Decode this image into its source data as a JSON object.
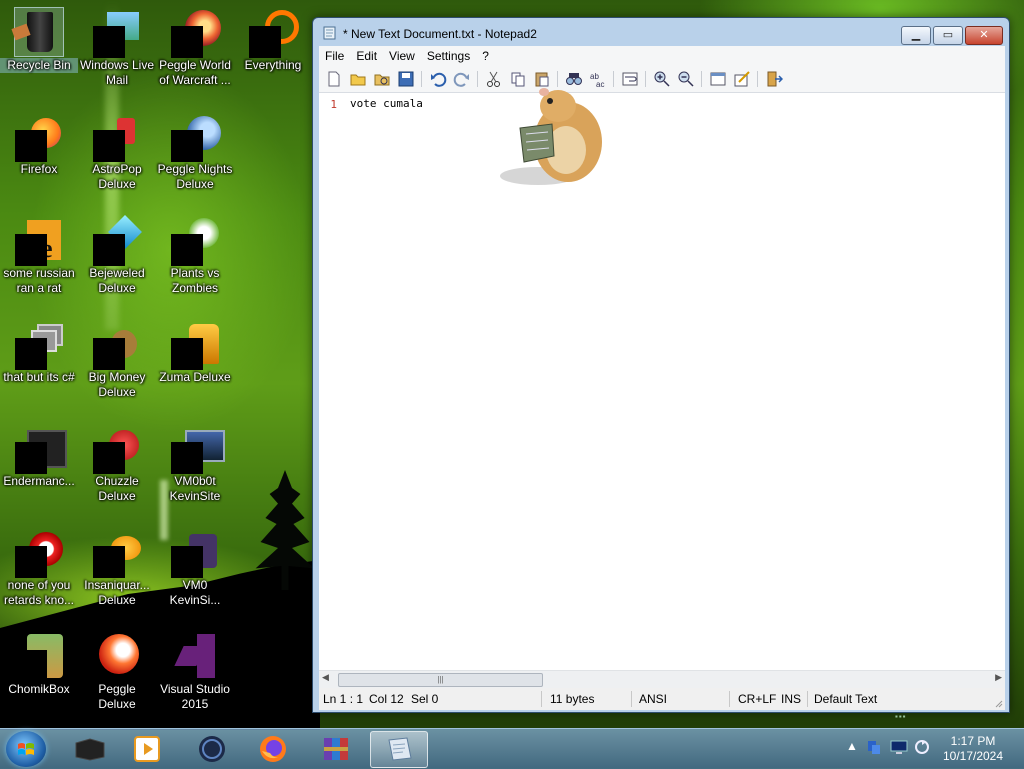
{
  "desktop": {
    "icons": [
      {
        "label": "Recycle Bin"
      },
      {
        "label": "Windows Live Mail"
      },
      {
        "label": "Peggle World of Warcraft ..."
      },
      {
        "label": "Everything"
      },
      {
        "label": "Firefox"
      },
      {
        "label": "AstroPop Deluxe"
      },
      {
        "label": "Peggle Nights Deluxe"
      },
      {
        "label": "some russian ran a rat"
      },
      {
        "label": "Bejeweled Deluxe"
      },
      {
        "label": "Plants vs Zombies"
      },
      {
        "label": "that but its c#"
      },
      {
        "label": "Big Money Deluxe"
      },
      {
        "label": "Zuma Deluxe"
      },
      {
        "label": "Endermanc..."
      },
      {
        "label": "Chuzzle Deluxe"
      },
      {
        "label": "VM0b0t KevinSite"
      },
      {
        "label": "none of you retards kno..."
      },
      {
        "label": "Insaniquar... Deluxe"
      },
      {
        "label": "VM0 KevinSi..."
      },
      {
        "label": "ChomikBox"
      },
      {
        "label": "Peggle Deluxe"
      },
      {
        "label": "Visual Studio 2015"
      }
    ]
  },
  "window": {
    "title": "* New Text Document.txt - Notepad2",
    "menu": [
      "File",
      "Edit",
      "View",
      "Settings",
      "?"
    ],
    "editor": {
      "line_numbers": [
        "1"
      ],
      "lines": [
        "vote cumala"
      ]
    },
    "status": {
      "position": "Ln 1 : 1",
      "column": "Col 12",
      "selection": "Sel 0",
      "size": "11 bytes",
      "encoding": "ANSI",
      "line_ending": "CR+LF",
      "insert_mode": "INS",
      "scheme": "Default Text"
    },
    "scroll_thumb_glyph": "|||"
  },
  "taskbar": {
    "clock_time": "1:17 PM",
    "clock_date": "10/17/2024",
    "tray_chevron": "▲"
  },
  "colors": {
    "title_close": "#c7442e",
    "line_number": "#c0392b",
    "taskbar": "#5d8fb3"
  }
}
